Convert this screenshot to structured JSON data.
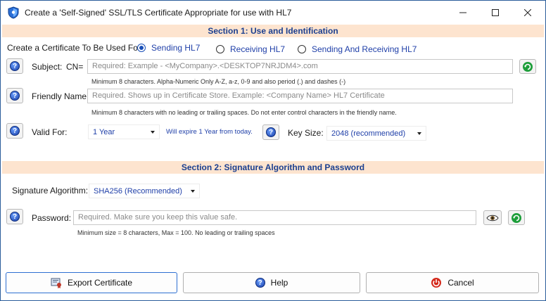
{
  "window": {
    "title": "Create a 'Self-Signed' SSL/TLS Certificate Appropriate for use with HL7"
  },
  "section1": {
    "header": "Section 1: Use and Identification",
    "use_for_label": "Create a Certificate To Be Used For:",
    "radios": [
      {
        "label": "Sending HL7",
        "selected": true
      },
      {
        "label": "Receiving HL7",
        "selected": false
      },
      {
        "label": "Sending And Receiving HL7",
        "selected": false
      }
    ],
    "subject_label": "Subject:",
    "cn_label": "CN=",
    "subject_placeholder": "Required: Example - <MyCompany>.<DESKTOP7NRJDM4>.com",
    "subject_note": "Minimum 8 characters. Alpha-Numeric Only A-Z, a-z, 0-9 and also period (.) and dashes (-)",
    "friendly_label": "Friendly Name:",
    "friendly_placeholder": "Required. Shows up in Certificate Store. Example: <Company Name> HL7 Certificate",
    "friendly_note": "Minimum 8 characters with no leading or trailing spaces. Do not enter control characters in the friendly name.",
    "valid_label": "Valid For:",
    "valid_value": "1 Year",
    "expire_note": "Will expire 1 Year from today.",
    "keysize_label": "Key Size:",
    "keysize_value": "2048 (recommended)"
  },
  "section2": {
    "header": "Section 2: Signature Algorithm and Password",
    "sig_label": "Signature Algorithm:",
    "sig_value": "SHA256 (Recommended)",
    "password_label": "Password:",
    "password_placeholder": "Required. Make sure you keep this value safe.",
    "password_note": "Minimum size = 8 characters, Max = 100. No leading or trailing spaces"
  },
  "footer": {
    "export_label": "Export Certificate",
    "help_label": "Help",
    "cancel_label": "Cancel"
  },
  "colors": {
    "accent_blue": "#1f3fa8",
    "section_bg": "#fde4cf",
    "window_border": "#2b5d9a"
  },
  "icons": {
    "title": "shield-icon",
    "help": "question-icon",
    "refresh": "refresh-icon",
    "eye": "eye-icon",
    "export": "certificate-icon",
    "cancel": "power-icon"
  }
}
